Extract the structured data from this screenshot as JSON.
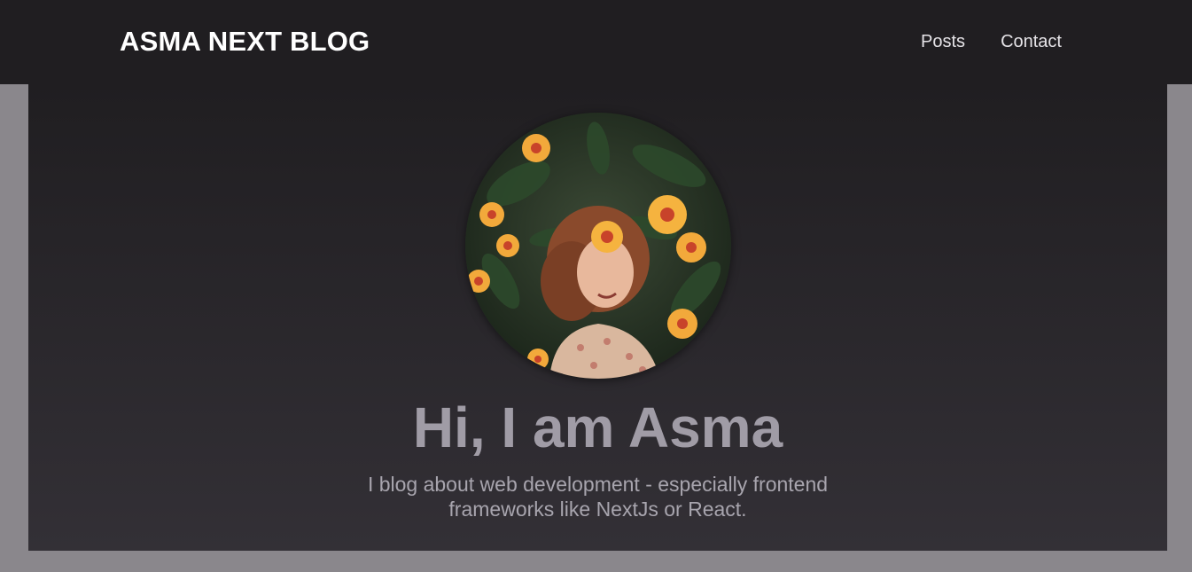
{
  "header": {
    "logo": "ASMA NEXT BLOG",
    "nav": [
      {
        "label": "Posts"
      },
      {
        "label": "Contact"
      }
    ]
  },
  "hero": {
    "avatar_icon": "profile-photo",
    "title": "Hi, I am Asma",
    "subtitle": "I blog about web development - especially frontend frameworks like NextJs or React."
  },
  "colors": {
    "header_bg": "#201e21",
    "page_bg": "#8a878c",
    "title": "#a09ca6"
  }
}
